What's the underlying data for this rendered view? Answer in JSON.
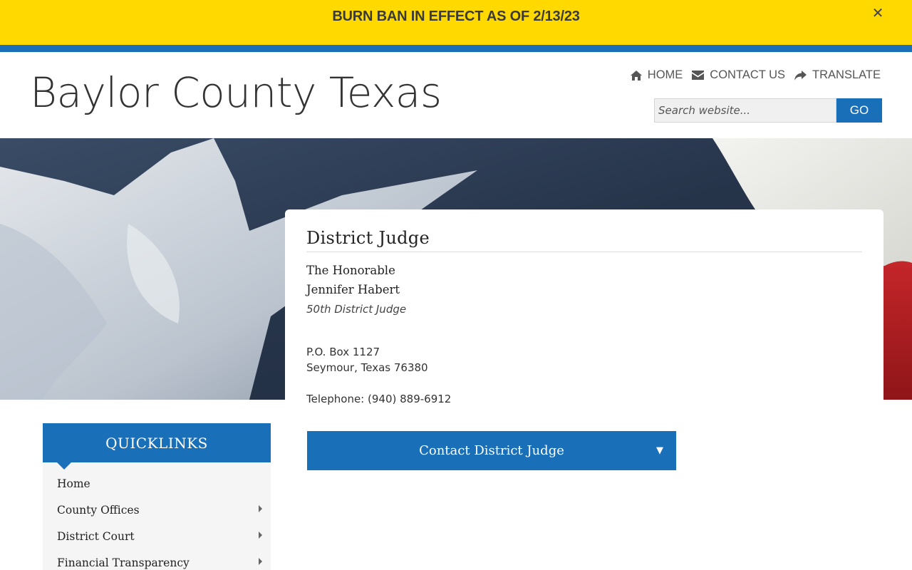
{
  "alert": {
    "text": "BURN BAN IN EFFECT AS OF 2/13/23",
    "close_glyph": "✕",
    "background": "#ffd900"
  },
  "brand_colors": {
    "primary_blue": "#1a6fb9"
  },
  "header": {
    "site_title": "Baylor County Texas",
    "nav": [
      {
        "label": "HOME",
        "icon": "home-icon"
      },
      {
        "label": "CONTACT US",
        "icon": "envelope-icon"
      },
      {
        "label": "TRANSLATE",
        "icon": "share-arrow-icon"
      }
    ],
    "search": {
      "placeholder": "Search website...",
      "button_label": "GO"
    }
  },
  "content": {
    "title": "District Judge",
    "honorable": "The Honorable",
    "name": "Jennifer Habert",
    "role": "50th District Judge",
    "address_line1": "P.O. Box 1127",
    "address_line2": "Seymour, Texas 76380",
    "telephone": "Telephone: (940) 889-6912",
    "contact_button": {
      "label": "Contact District Judge",
      "caret": "▼"
    }
  },
  "quicklinks": {
    "title": "QUICKLINKS",
    "items": [
      {
        "label": "Home",
        "has_submenu": false
      },
      {
        "label": "County Offices",
        "has_submenu": true
      },
      {
        "label": "District Court",
        "has_submenu": true
      },
      {
        "label": "Financial Transparency",
        "has_submenu": true
      }
    ]
  }
}
